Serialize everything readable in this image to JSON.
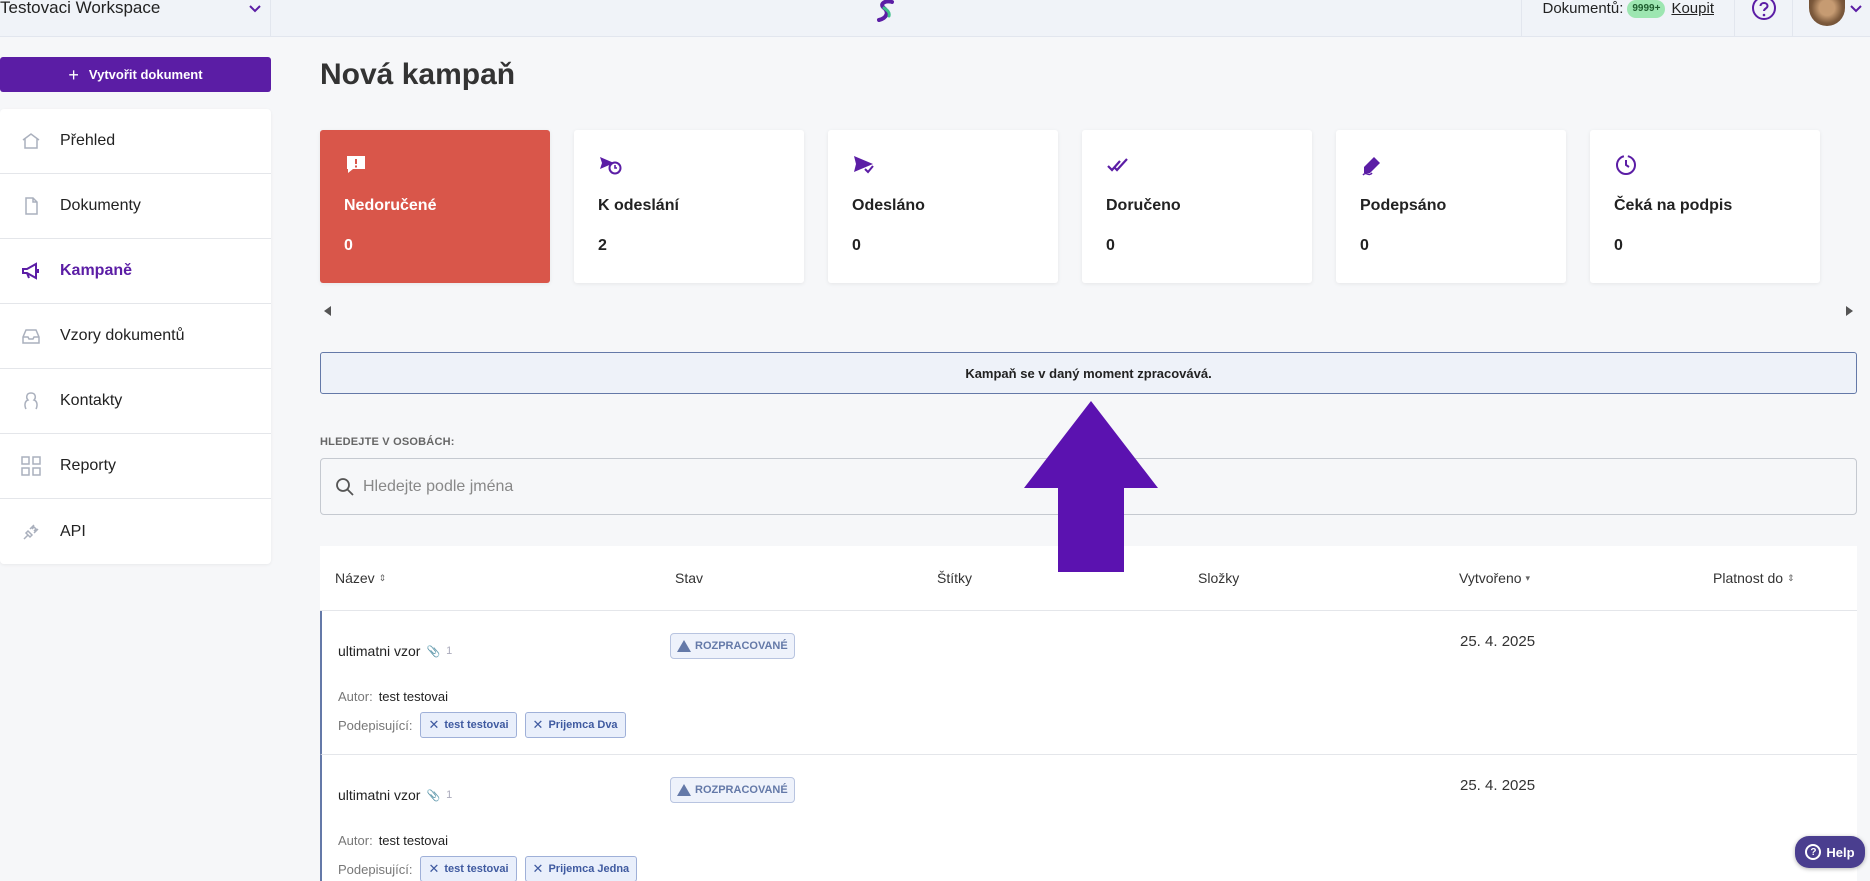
{
  "topbar": {
    "workspace": "Testovaci Workspace",
    "credits_label": "Dokumentů:",
    "credits_badge": "9999+",
    "buy_label": "Koupit"
  },
  "sidebar": {
    "create_label": "Vytvořit dokument",
    "items": [
      {
        "label": "Přehled",
        "icon": "home-icon"
      },
      {
        "label": "Dokumenty",
        "icon": "document-icon"
      },
      {
        "label": "Kampaně",
        "icon": "megaphone-icon",
        "active": true
      },
      {
        "label": "Vzory dokumentů",
        "icon": "inbox-icon"
      },
      {
        "label": "Kontakty",
        "icon": "contact-icon"
      },
      {
        "label": "Reporty",
        "icon": "grid-icon"
      },
      {
        "label": "API",
        "icon": "plug-icon"
      }
    ]
  },
  "main": {
    "title": "Nová kampaň",
    "cards": [
      {
        "label": "Nedoručené",
        "value": "0",
        "icon": "alert-message-icon",
        "highlight": "#d9564a"
      },
      {
        "label": "K odeslání",
        "value": "2",
        "icon": "send-clock-icon"
      },
      {
        "label": "Odesláno",
        "value": "0",
        "icon": "send-icon"
      },
      {
        "label": "Doručeno",
        "value": "0",
        "icon": "double-check-icon"
      },
      {
        "label": "Podepsáno",
        "value": "0",
        "icon": "pen-icon"
      },
      {
        "label": "Čeká na podpis",
        "value": "0",
        "icon": "clock-icon"
      }
    ],
    "banner": "Kampaň se v daný moment zpracovává.",
    "search_label": "HLEDEJTE V OSOBÁCH:",
    "search_placeholder": "Hledejte podle jména",
    "table": {
      "headers": {
        "name": "Název",
        "status": "Stav",
        "tags": "Štítky",
        "folders": "Složky",
        "created": "Vytvořeno",
        "valid_until": "Platnost do"
      },
      "rows": [
        {
          "name": "ultimatni vzor",
          "attachments": "1",
          "status": "ROZPRACOVANÉ",
          "created": "25. 4. 2025",
          "author_label": "Autor:",
          "author": "test testovai",
          "signers_label": "Podepisující:",
          "signers": [
            "test testovai",
            "Prijemca Dva"
          ]
        },
        {
          "name": "ultimatni vzor",
          "attachments": "1",
          "status": "ROZPRACOVANÉ",
          "created": "25. 4. 2025",
          "author_label": "Autor:",
          "author": "test testovai",
          "signers_label": "Podepisující:",
          "signers": [
            "test testovai",
            "Prijemca Jedna"
          ]
        }
      ]
    }
  },
  "help_button": "Help",
  "colors": {
    "brand": "#5b1da5",
    "alert": "#d9564a",
    "status": "#6479a8"
  }
}
